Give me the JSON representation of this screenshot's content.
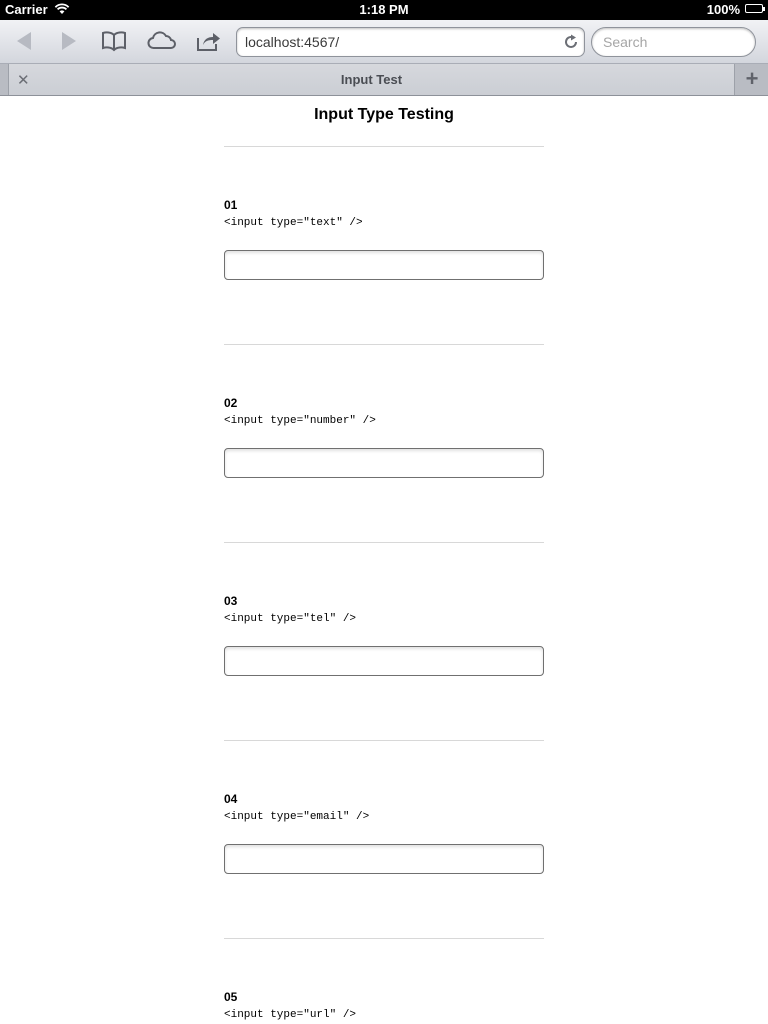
{
  "status_bar": {
    "carrier": "Carrier",
    "time": "1:18 PM",
    "battery": "100%",
    "battery_level": 1.0
  },
  "toolbar": {
    "icons": [
      "back-arrow-icon",
      "forward-arrow-icon",
      "bookmarks-book-icon",
      "icloud-icon",
      "share-icon"
    ],
    "url": "localhost:4567/",
    "reload_icon": "reload-icon",
    "search_placeholder": "Search"
  },
  "tabbar": {
    "tab_title": "Input Test",
    "close_glyph": "✕",
    "new_tab_glyph": "+"
  },
  "page": {
    "title": "Input Type Testing",
    "items": [
      {
        "number": "01",
        "code": "<input type=\"text\" />",
        "value": ""
      },
      {
        "number": "02",
        "code": "<input type=\"number\" />",
        "value": ""
      },
      {
        "number": "03",
        "code": "<input type=\"tel\" />",
        "value": ""
      },
      {
        "number": "04",
        "code": "<input type=\"email\" />",
        "value": ""
      },
      {
        "number": "05",
        "code": "<input type=\"url\" />",
        "value": ""
      }
    ]
  }
}
